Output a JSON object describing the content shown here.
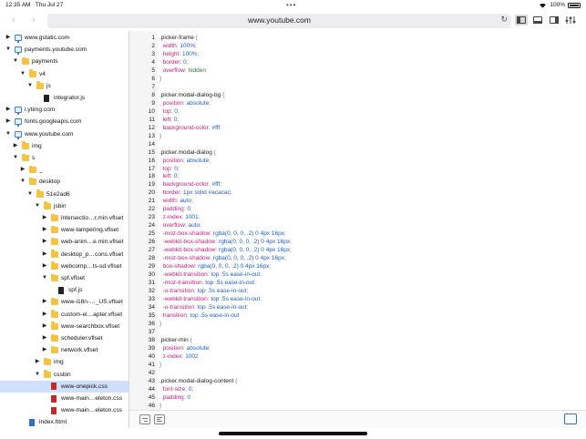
{
  "status_bar": {
    "time": "12:35 AM",
    "date": "Thu Jul 27",
    "battery": "100%"
  },
  "toolbar": {
    "url": "www.youtube.com",
    "back_icon": "chevron-left-icon",
    "forward_icon": "chevron-right-icon",
    "reload_icon": "reload-icon"
  },
  "sidebar": {
    "items": [
      {
        "label": "www.gstatic.com",
        "depth": 0,
        "type": "domain",
        "state": "collapsed"
      },
      {
        "label": "payments.youtube.com",
        "depth": 0,
        "type": "domain",
        "state": "expanded"
      },
      {
        "label": "payments",
        "depth": 1,
        "type": "folder",
        "state": "expanded"
      },
      {
        "label": "v4",
        "depth": 2,
        "type": "folder",
        "state": "expanded"
      },
      {
        "label": "js",
        "depth": 3,
        "type": "folder",
        "state": "expanded"
      },
      {
        "label": "integrator.js",
        "depth": 4,
        "type": "file",
        "state": "none"
      },
      {
        "label": "i.ytimg.com",
        "depth": 0,
        "type": "domain",
        "state": "collapsed"
      },
      {
        "label": "fonts.googleapis.com",
        "depth": 0,
        "type": "domain",
        "state": "collapsed"
      },
      {
        "label": "www.youtube.com",
        "depth": 0,
        "type": "domain",
        "state": "expanded"
      },
      {
        "label": "img",
        "depth": 1,
        "type": "folder",
        "state": "collapsed"
      },
      {
        "label": "s",
        "depth": 1,
        "type": "folder",
        "state": "expanded"
      },
      {
        "label": "_",
        "depth": 2,
        "type": "folder",
        "state": "collapsed"
      },
      {
        "label": "desktop",
        "depth": 2,
        "type": "folder",
        "state": "expanded"
      },
      {
        "label": "51e2ad6",
        "depth": 3,
        "type": "folder",
        "state": "expanded"
      },
      {
        "label": "jsbin",
        "depth": 4,
        "type": "folder",
        "state": "expanded"
      },
      {
        "label": "intersectio…r.min.vflset",
        "depth": 5,
        "type": "folder",
        "state": "collapsed"
      },
      {
        "label": "www-tampering.vflset",
        "depth": 5,
        "type": "folder",
        "state": "collapsed"
      },
      {
        "label": "web-anim…e.min.vflset",
        "depth": 5,
        "type": "folder",
        "state": "collapsed"
      },
      {
        "label": "desktop_p…cons.vflset",
        "depth": 5,
        "type": "folder",
        "state": "collapsed"
      },
      {
        "label": "webcomp…ts-sd.vflset",
        "depth": 5,
        "type": "folder",
        "state": "collapsed"
      },
      {
        "label": "spf.vflset",
        "depth": 5,
        "type": "folder",
        "state": "expanded"
      },
      {
        "label": "spf.js",
        "depth": 6,
        "type": "file",
        "state": "none"
      },
      {
        "label": "www-i18n-…_US.vflset",
        "depth": 5,
        "type": "folder",
        "state": "collapsed"
      },
      {
        "label": "custom-el…apter.vflset",
        "depth": 5,
        "type": "folder",
        "state": "collapsed"
      },
      {
        "label": "www-searchbox.vflset",
        "depth": 5,
        "type": "folder",
        "state": "collapsed"
      },
      {
        "label": "scheduler.vflset",
        "depth": 5,
        "type": "folder",
        "state": "collapsed"
      },
      {
        "label": "network.vflset",
        "depth": 5,
        "type": "folder",
        "state": "collapsed"
      },
      {
        "label": "img",
        "depth": 4,
        "type": "folder",
        "state": "collapsed"
      },
      {
        "label": "cssbin",
        "depth": 4,
        "type": "folder",
        "state": "expanded"
      },
      {
        "label": "www-onepick.css",
        "depth": 5,
        "type": "css",
        "state": "none",
        "selected": true
      },
      {
        "label": "www-main…eleton.css",
        "depth": 5,
        "type": "css",
        "state": "none"
      },
      {
        "label": "www-main…eleton.css",
        "depth": 5,
        "type": "css",
        "state": "none"
      },
      {
        "label": "index.html",
        "depth": 2,
        "type": "doc",
        "state": "none"
      }
    ]
  },
  "editor": {
    "lines": [
      [
        [
          "sel",
          ".picker-frame "
        ],
        [
          "punc",
          "{"
        ]
      ],
      [
        [
          "prop",
          "  width"
        ],
        [
          "punc",
          ": "
        ],
        [
          "val",
          "100%"
        ],
        [
          "punc",
          ";"
        ]
      ],
      [
        [
          "prop",
          "  height"
        ],
        [
          "punc",
          ": "
        ],
        [
          "val",
          "100%"
        ],
        [
          "punc",
          ";"
        ]
      ],
      [
        [
          "prop",
          "  border"
        ],
        [
          "punc",
          ": "
        ],
        [
          "val",
          "0"
        ],
        [
          "punc",
          ";"
        ]
      ],
      [
        [
          "prop",
          "  overflow"
        ],
        [
          "punc",
          ": "
        ],
        [
          "str",
          "hidden"
        ]
      ],
      [
        [
          "punc",
          "}"
        ]
      ],
      [],
      [
        [
          "sel",
          ".picker.modal-dialog-bg "
        ],
        [
          "punc",
          "{"
        ]
      ],
      [
        [
          "prop",
          "  position"
        ],
        [
          "punc",
          ": "
        ],
        [
          "val",
          "absolute"
        ],
        [
          "punc",
          ";"
        ]
      ],
      [
        [
          "prop",
          "  top"
        ],
        [
          "punc",
          ": "
        ],
        [
          "val",
          "0"
        ],
        [
          "punc",
          ";"
        ]
      ],
      [
        [
          "prop",
          "  left"
        ],
        [
          "punc",
          ": "
        ],
        [
          "val",
          "0"
        ],
        [
          "punc",
          ";"
        ]
      ],
      [
        [
          "prop",
          "  background-color"
        ],
        [
          "punc",
          ": "
        ],
        [
          "val",
          "#fff"
        ]
      ],
      [
        [
          "punc",
          "}"
        ]
      ],
      [],
      [
        [
          "sel",
          ".picker.modal-dialog "
        ],
        [
          "punc",
          "{"
        ]
      ],
      [
        [
          "prop",
          "  position"
        ],
        [
          "punc",
          ": "
        ],
        [
          "val",
          "absolute"
        ],
        [
          "punc",
          ";"
        ]
      ],
      [
        [
          "prop",
          "  top"
        ],
        [
          "punc",
          ": "
        ],
        [
          "val",
          "0"
        ],
        [
          "punc",
          ";"
        ]
      ],
      [
        [
          "prop",
          "  left"
        ],
        [
          "punc",
          ": "
        ],
        [
          "val",
          "0"
        ],
        [
          "punc",
          ";"
        ]
      ],
      [
        [
          "prop",
          "  background-color"
        ],
        [
          "punc",
          ": "
        ],
        [
          "val",
          "#fff"
        ],
        [
          "punc",
          ";"
        ]
      ],
      [
        [
          "prop",
          "  border"
        ],
        [
          "punc",
          ": "
        ],
        [
          "val",
          "1px solid "
        ],
        [
          "val",
          "#acacac"
        ],
        [
          "punc",
          ";"
        ]
      ],
      [
        [
          "prop",
          "  width"
        ],
        [
          "punc",
          ": "
        ],
        [
          "val",
          "auto"
        ],
        [
          "punc",
          ";"
        ]
      ],
      [
        [
          "prop",
          "  padding"
        ],
        [
          "punc",
          ": "
        ],
        [
          "val",
          "0"
        ],
        [
          "punc",
          ";"
        ]
      ],
      [
        [
          "prop",
          "  z-index"
        ],
        [
          "punc",
          ": "
        ],
        [
          "val",
          "1001"
        ],
        [
          "punc",
          ";"
        ]
      ],
      [
        [
          "prop",
          "  overflow"
        ],
        [
          "punc",
          ": "
        ],
        [
          "val",
          "auto"
        ],
        [
          "punc",
          ";"
        ]
      ],
      [
        [
          "prop",
          "  -moz-box-shadow"
        ],
        [
          "punc",
          ": "
        ],
        [
          "val",
          "rgba(0, 0, 0, .2) 0 4px 16px"
        ],
        [
          "punc",
          ";"
        ]
      ],
      [
        [
          "prop",
          "  -webkit-box-shadow"
        ],
        [
          "punc",
          ": "
        ],
        [
          "val",
          "rgba(0, 0, 0, .2) 0 4px 16px"
        ],
        [
          "punc",
          ";"
        ]
      ],
      [
        [
          "prop",
          "  -webkit-box-shadow"
        ],
        [
          "punc",
          ": "
        ],
        [
          "val",
          "rgba(0, 0, 0, .2) 0 4px 16px"
        ],
        [
          "punc",
          ";"
        ]
      ],
      [
        [
          "prop",
          "  -moz-box-shadow"
        ],
        [
          "punc",
          ": "
        ],
        [
          "val",
          "rgba(0, 0, 0, .2) 0 4px 16px"
        ],
        [
          "punc",
          ";"
        ]
      ],
      [
        [
          "prop",
          "  box-shadow"
        ],
        [
          "punc",
          ": "
        ],
        [
          "val",
          "rgba(0, 0, 0, .2) 0 4px 16px"
        ],
        [
          "punc",
          ";"
        ]
      ],
      [
        [
          "prop",
          "  -webkit-transition"
        ],
        [
          "punc",
          ": "
        ],
        [
          "val",
          "top .5s ease-in-out"
        ],
        [
          "punc",
          ";"
        ]
      ],
      [
        [
          "prop",
          "  -moz-transition"
        ],
        [
          "punc",
          ": "
        ],
        [
          "val",
          "top .5s ease-in-out"
        ],
        [
          "punc",
          ";"
        ]
      ],
      [
        [
          "prop",
          "  -o-transition"
        ],
        [
          "punc",
          ": "
        ],
        [
          "val",
          "top .5s ease-in-out"
        ],
        [
          "punc",
          ";"
        ]
      ],
      [
        [
          "prop",
          "  -webkit-transition"
        ],
        [
          "punc",
          ": "
        ],
        [
          "val",
          "top .5s ease-in-out"
        ],
        [
          "punc",
          ";"
        ]
      ],
      [
        [
          "prop",
          "  -o-transition"
        ],
        [
          "punc",
          ": "
        ],
        [
          "val",
          "top .5s ease-in-out"
        ],
        [
          "punc",
          ";"
        ]
      ],
      [
        [
          "prop",
          "  transition"
        ],
        [
          "punc",
          ": "
        ],
        [
          "val",
          "top .5s ease-in-out"
        ]
      ],
      [
        [
          "punc",
          "}"
        ]
      ],
      [],
      [
        [
          "sel",
          ".picker-min "
        ],
        [
          "punc",
          "{"
        ]
      ],
      [
        [
          "prop",
          "  position"
        ],
        [
          "punc",
          ": "
        ],
        [
          "val",
          "absolute"
        ],
        [
          "punc",
          ";"
        ]
      ],
      [
        [
          "prop",
          "  z-index"
        ],
        [
          "punc",
          ": "
        ],
        [
          "val",
          "1002"
        ]
      ],
      [
        [
          "punc",
          "}"
        ]
      ],
      [],
      [
        [
          "sel",
          ".picker.modal-dialog-content "
        ],
        [
          "punc",
          "{"
        ]
      ],
      [
        [
          "prop",
          "  font-size"
        ],
        [
          "punc",
          ": "
        ],
        [
          "val",
          "0"
        ],
        [
          "punc",
          ";"
        ]
      ],
      [
        [
          "prop",
          "  padding"
        ],
        [
          "punc",
          ": "
        ],
        [
          "val",
          "0"
        ]
      ],
      [
        [
          "punc",
          "}"
        ]
      ]
    ]
  }
}
